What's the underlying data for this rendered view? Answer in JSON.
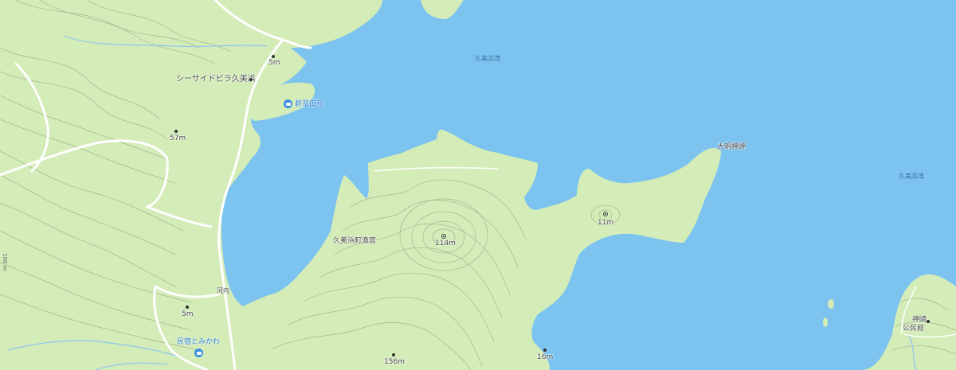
{
  "map": {
    "colors": {
      "water": "#7cc4ef",
      "land": "#d3ecb8",
      "contour": "#9aa98c",
      "road": "#ffffff",
      "river": "#8ec8ee",
      "poi_blue": "#2f7fd3"
    },
    "water_labels": {
      "bay_north": "久美浜湾",
      "bay_east": "久美浜湾"
    },
    "places": {
      "seaside_villa": "シーサイドビラ久美浜",
      "hisui_gyoen": "碧翠御苑",
      "daimyo_jinja_cape": "大明神岬",
      "hydro_obs": "久美浜町漁官",
      "kochi": "河内",
      "minshuku": "民宿とみかわ",
      "kanzaki_hall_1": "神崎",
      "kanzaki_hall_2": "公民館"
    },
    "elevations": {
      "e1": "5m",
      "e2": "57m",
      "e3": "114m",
      "e4": "11m",
      "e5": "5m",
      "e6": "156m",
      "e7": "16m"
    },
    "road_label": "100 m"
  }
}
